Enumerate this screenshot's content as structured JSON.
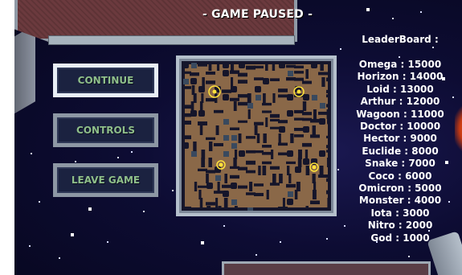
{
  "header": {
    "title": "- GAME PAUSED -"
  },
  "menu": {
    "buttons": [
      {
        "label": "CONTINUE",
        "selected": true
      },
      {
        "label": "CONTROLS",
        "selected": false
      },
      {
        "label": "LEAVE GAME",
        "selected": false
      }
    ]
  },
  "leaderboard": {
    "title": "LeaderBoard :",
    "entries": [
      "Omega : 15000",
      "Horizon : 14000",
      "Loid : 13000",
      "Arthur : 12000",
      "Wagoon : 11000",
      "Doctor : 10000",
      "Hector : 9000",
      "Euclide : 8000",
      "Snake : 7000",
      "Coco : 6000",
      "Omicron : 5000",
      "Monster : 4000",
      "Iota : 3000",
      "Nitro : 2000",
      "God : 1000"
    ]
  },
  "minimap": {
    "player_markers": 4,
    "colors": {
      "floor": "#8a6848",
      "wall": "#15152a",
      "water": "#39495e",
      "marker": "#ffe23a"
    }
  },
  "colors": {
    "background": "#0d0c33",
    "button_text": "#8fbf8a",
    "frame": "#8d97a4",
    "selected_frame": "#e8eef5"
  }
}
